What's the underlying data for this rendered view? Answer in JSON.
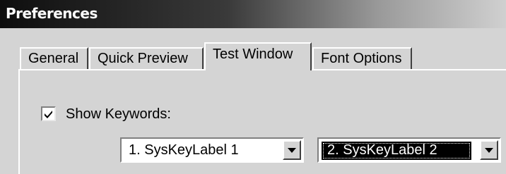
{
  "window": {
    "title": "Preferences"
  },
  "tabs": [
    {
      "label": "General",
      "active": false
    },
    {
      "label": "Quick Preview",
      "active": false
    },
    {
      "label": "Test Window",
      "active": true
    },
    {
      "label": "Font Options",
      "active": false
    }
  ],
  "content": {
    "show_keywords": {
      "label": "Show Keywords:",
      "checked": true
    },
    "key_select_1": {
      "value": "1. SysKeyLabel 1",
      "focused": false
    },
    "key_select_2": {
      "value": "2. SysKeyLabel 2",
      "focused": true
    }
  },
  "colors": {
    "titlebar_start": "#0e0e0e",
    "titlebar_end": "#d0d0d0",
    "dialog_bg": "#d4d4d4",
    "selection_bg": "#000000",
    "selection_text": "#ffffff"
  },
  "icons": {
    "checkbox_mark": "check-icon",
    "dropdown": "chevron-down-icon"
  }
}
